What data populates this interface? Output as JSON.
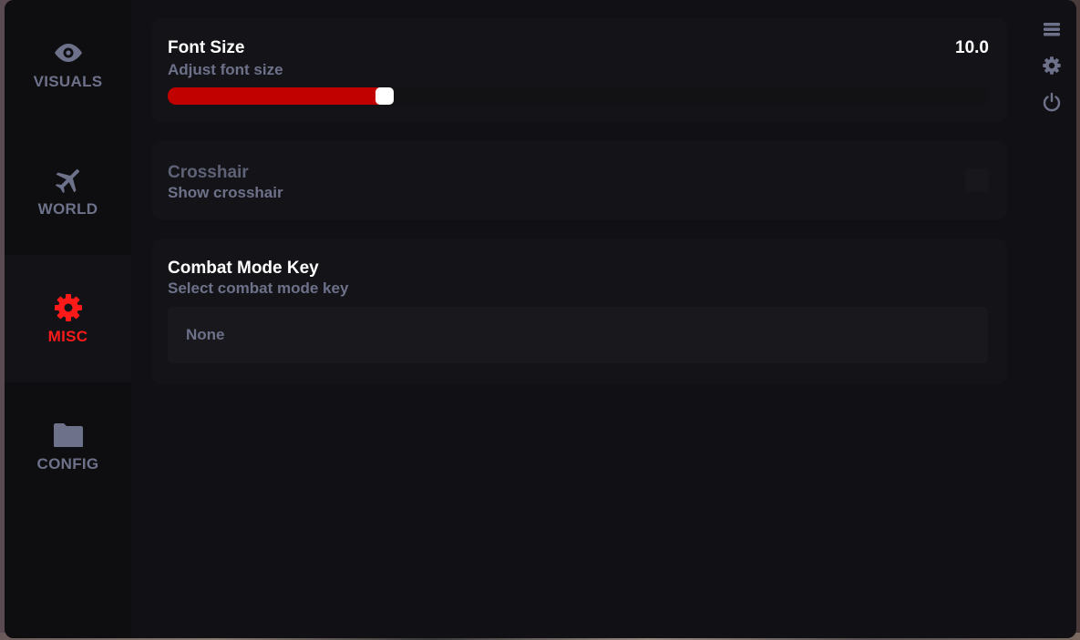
{
  "sidebar": {
    "items": [
      {
        "label": "VISUALS",
        "icon": "eye-icon",
        "active": false
      },
      {
        "label": "WORLD",
        "icon": "plane-icon",
        "active": false
      },
      {
        "label": "MISC",
        "icon": "gear-icon",
        "active": true
      },
      {
        "label": "CONFIG",
        "icon": "folder-icon",
        "active": false
      }
    ]
  },
  "settings": {
    "font_size": {
      "title": "Font Size",
      "subtitle": "Adjust font size",
      "value_text": "10.0",
      "fill_fraction": 0.26
    },
    "crosshair": {
      "title": "Crosshair",
      "subtitle": "Show crosshair",
      "checked": false
    },
    "combat_mode_key": {
      "title": "Combat Mode Key",
      "subtitle": "Select combat mode key",
      "value": "None"
    }
  },
  "top_icons": [
    "menu-icon",
    "gear-icon",
    "power-icon"
  ],
  "colors": {
    "accent": "#ff1a1a",
    "slider_fill": "#c10000",
    "muted": "#6d7189",
    "background": "#111115"
  }
}
